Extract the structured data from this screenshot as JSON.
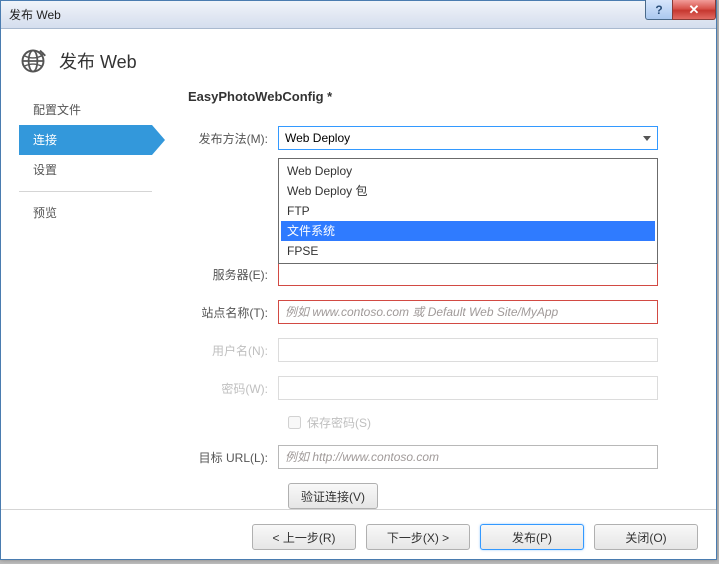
{
  "window": {
    "title": "发布 Web"
  },
  "header": {
    "title": "发布 Web"
  },
  "sidebar": {
    "items": [
      {
        "label": "配置文件"
      },
      {
        "label": "连接",
        "active": true
      },
      {
        "label": "设置"
      },
      {
        "label": "预览"
      }
    ]
  },
  "form": {
    "profile_title": "EasyPhotoWebConfig *",
    "publish_method_label": "发布方法(M):",
    "publish_method_value": "Web Deploy",
    "dropdown_options": [
      {
        "label": "Web Deploy"
      },
      {
        "label": "Web Deploy 包"
      },
      {
        "label": "FTP"
      },
      {
        "label": "文件系统",
        "selected": true
      },
      {
        "label": "FPSE"
      }
    ],
    "server_label": "服务器(E):",
    "server_value": "",
    "site_label": "站点名称(T):",
    "site_placeholder": "例如 www.contoso.com 或 Default Web Site/MyApp",
    "site_value": "",
    "username_label": "用户名(N):",
    "password_label": "密码(W):",
    "save_password_label": "保存密码(S)",
    "dest_url_label": "目标 URL(L):",
    "dest_url_placeholder": "例如 http://www.contoso.com",
    "dest_url_value": "",
    "validate_button": "验证连接(V)"
  },
  "footer": {
    "prev": "< 上一步(R)",
    "next": "下一步(X) >",
    "publish": "发布(P)",
    "close": "关闭(O)"
  }
}
